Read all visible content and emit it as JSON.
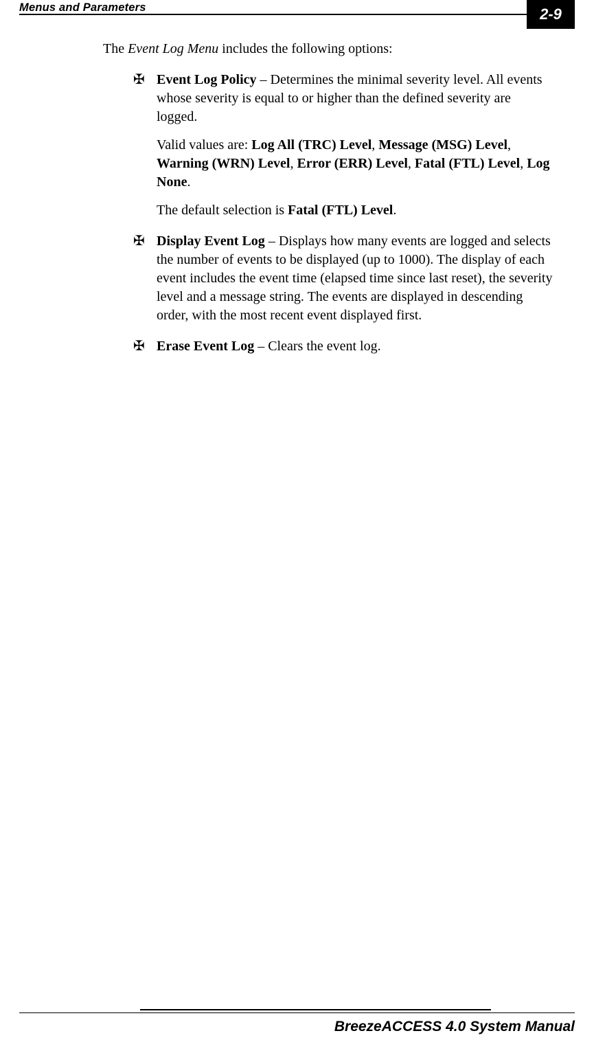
{
  "header": {
    "section_title": "Menus and Parameters",
    "page_number": "2-9"
  },
  "intro": {
    "prefix": "The ",
    "menu_name": "Event Log Menu",
    "suffix": " includes the following options:"
  },
  "items": [
    {
      "title": "Event Log Policy",
      "sep": " – ",
      "body": "Determines the minimal severity level. All events whose severity is equal to or higher than the defined severity are logged.",
      "valid_prefix": "Valid values are: ",
      "valid_values": [
        "Log All (TRC) Level",
        "Message (MSG) Level",
        "Warning (WRN) Level",
        "Error (ERR) Level",
        "Fatal (FTL) Level",
        "Log None"
      ],
      "default_prefix": "The default selection is ",
      "default_value": "Fatal (FTL) Level",
      "default_suffix": "."
    },
    {
      "title": "Display Event Log",
      "sep": " – ",
      "body": "Displays how many events are logged and selects the number of events to be displayed (up to 1000). The display of each event includes the event time (elapsed time since last reset), the severity level and a message string. The events are displayed in descending order, with the most recent event displayed first."
    },
    {
      "title": "Erase Event Log",
      "sep": " – ",
      "body": "Clears the event log."
    }
  ],
  "footer": {
    "manual_title": "BreezeACCESS 4.0 System Manual"
  }
}
